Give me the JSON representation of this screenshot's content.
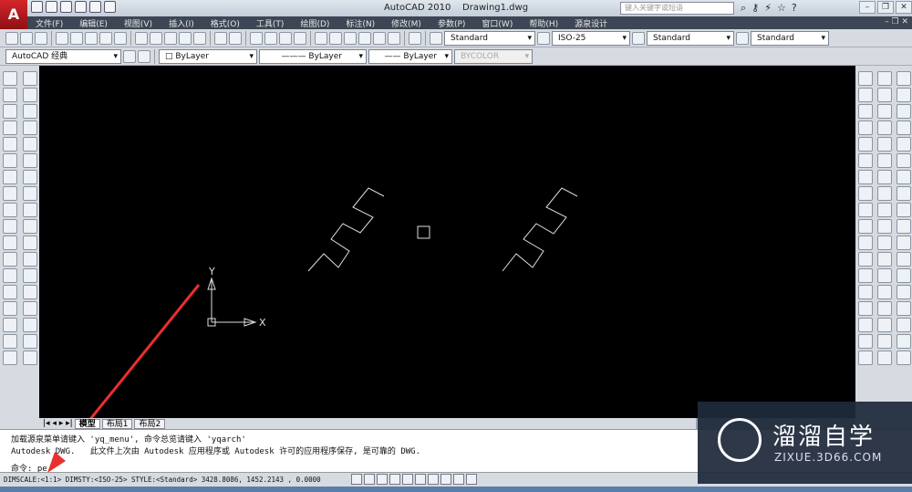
{
  "window": {
    "app": "AutoCAD 2010",
    "file": "Drawing1.dwg",
    "search_placeholder": "键入关键字或短语"
  },
  "menu": [
    "文件(F)",
    "编辑(E)",
    "视图(V)",
    "插入(I)",
    "格式(O)",
    "工具(T)",
    "绘图(D)",
    "标注(N)",
    "修改(M)",
    "参数(P)",
    "窗口(W)",
    "帮助(H)",
    "源泉设计"
  ],
  "toolbar1": {
    "text_style": "Standard",
    "dim_style": "ISO-25",
    "table_style": "Standard",
    "mleader_style": "Standard"
  },
  "toolbar2": {
    "workspace": "AutoCAD 经典",
    "layer": "ByLayer",
    "linetype": "ByLayer",
    "lineweight": "ByLayer",
    "plotstyle": "BYCOLOR"
  },
  "ucs": {
    "x": "X",
    "y": "Y"
  },
  "tabs": [
    "模型",
    "布局1",
    "布局2"
  ],
  "command": {
    "line1": "加载源泉菜单请键入 'yq_menu', 命令总览请键入 'yqarch'",
    "line2": "Autodesk DWG.   此文件上次由 Autodesk 应用程序或 Autodesk 许可的应用程序保存, 是可靠的 DWG.",
    "prompt": "命令: pe"
  },
  "status": {
    "text": "DIMSCALE:<1:1> DIMSTY:<ISO-25> STYLE:<Standard>  3428.8086,  1452.2143 , 0.0000"
  },
  "watermark": {
    "name": "溜溜自学",
    "url": "ZIXUE.3D66.COM"
  },
  "colors": {
    "canvas": "#000000",
    "arrow": "#e8302e",
    "menubar": "#3d4654"
  }
}
